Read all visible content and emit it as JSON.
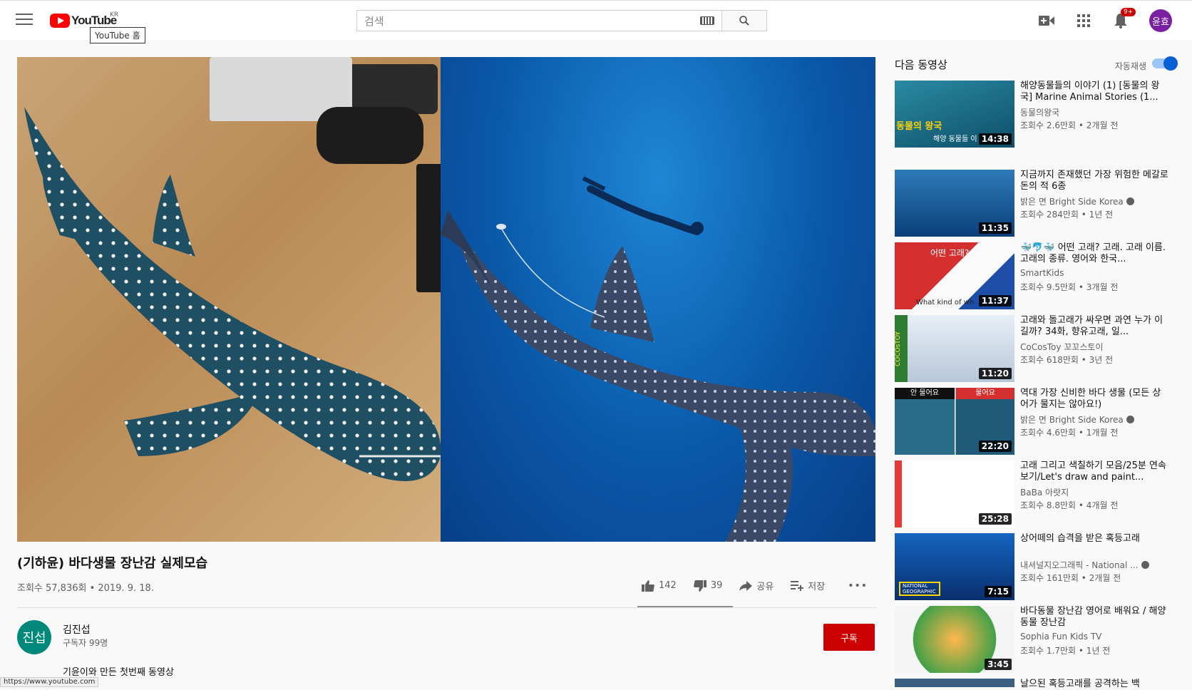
{
  "topbar": {
    "logo_text": "YouTube",
    "region": "KR",
    "tooltip": "YouTube 홈",
    "search_placeholder": "검색",
    "notification_count": "9+",
    "avatar_text": "윤효"
  },
  "video": {
    "title": "(기하윤) 바다생물 장난감 실제모습",
    "views_date": "조회수 57,836회 • 2019. 9. 18.",
    "likes": "142",
    "dislikes": "39",
    "share_label": "공유",
    "save_label": "저장",
    "more_label": "•••"
  },
  "channel": {
    "avatar_text": "진섭",
    "name": "김진섭",
    "subscribers": "구독자 99명",
    "subscribe_label": "구독",
    "description": "기윤이와 만든 첫번째 동영상"
  },
  "status_url": "https://www.youtube.com",
  "sidebar": {
    "header": "다음 동영상",
    "autoplay_label": "자동재생",
    "items": [
      {
        "title": "해양동물들의 이야기 (1) [동물의 왕국] Marine Animal Stories (1...",
        "channel": "동물의왕국",
        "meta": "조회수 2.6만회 • 2개월 전",
        "duration": "14:38",
        "verified": false,
        "thumb_overlay": "동물의 왕국",
        "thumb_sub": "해양 동물들 이"
      },
      {
        "title": "지금까지 존재했던 가장 위험한 메갈로돈의 적 6종",
        "channel": "밝은 면 Bright Side Korea",
        "meta": "조회수 284만회 • 1년 전",
        "duration": "11:35",
        "verified": true
      },
      {
        "title": "🐳🐬🐳 어떤 고래? 고래. 고래 이름. 고래의 종류. 영어와 한국...",
        "channel": "SmartKids",
        "meta": "조회수 9.5만회 • 3개월 전",
        "duration": "11:37",
        "verified": false,
        "thumb_overlay": "어떤 고래?",
        "thumb_sub": "What kind of wh"
      },
      {
        "title": "고래와 돌고래가 싸우면 과연 누가 이길까? 34화, 향유고래, 일...",
        "channel": "CoCosToy 꼬꼬스토이",
        "meta": "조회수 618만회 • 3년 전",
        "duration": "11:20",
        "verified": false,
        "thumb_overlay": "COCOsTOY"
      },
      {
        "title": "역대 가장 신비한 바다 생물 (모든 상어가 물지는 않아요!)",
        "channel": "밝은 면 Bright Side Korea",
        "meta": "조회수 4.6만회 • 1개월 전",
        "duration": "22:20",
        "verified": true,
        "thumb_overlay": "안 물어요",
        "thumb_sub": "물어요"
      },
      {
        "title": "고래 그리고 색칠하기 모음/25분 연속보기/Let's draw and paint...",
        "channel": "BaBa 아랏지",
        "meta": "조회수 8.8만회 • 4개월 전",
        "duration": "25:28",
        "verified": false
      },
      {
        "title": "상어떼의 습격을 받은 혹등고래",
        "channel": "내셔널지오그래픽 - National ...",
        "meta": "조회수 161만회 • 2개월 전",
        "duration": "7:15",
        "verified": true,
        "thumb_overlay": "NATIONAL GEOGRAPHIC"
      },
      {
        "title": "바다동물 장난감 영어로 배워요 / 해양동물 장난감",
        "channel": "Sophia Fun Kids TV",
        "meta": "조회수 1.7만회 • 1년 전",
        "duration": "3:45",
        "verified": false
      },
      {
        "title": "날으된 혹등고래를 공격하는 백",
        "channel": "",
        "meta": "",
        "duration": "",
        "verified": false
      }
    ]
  },
  "colors": {
    "brand_red": "#ff0000",
    "subscribe_red": "#cc0000",
    "toggle_blue": "#065fd4",
    "channel_avatar": "#00897b",
    "user_avatar": "#7b1fa2"
  }
}
